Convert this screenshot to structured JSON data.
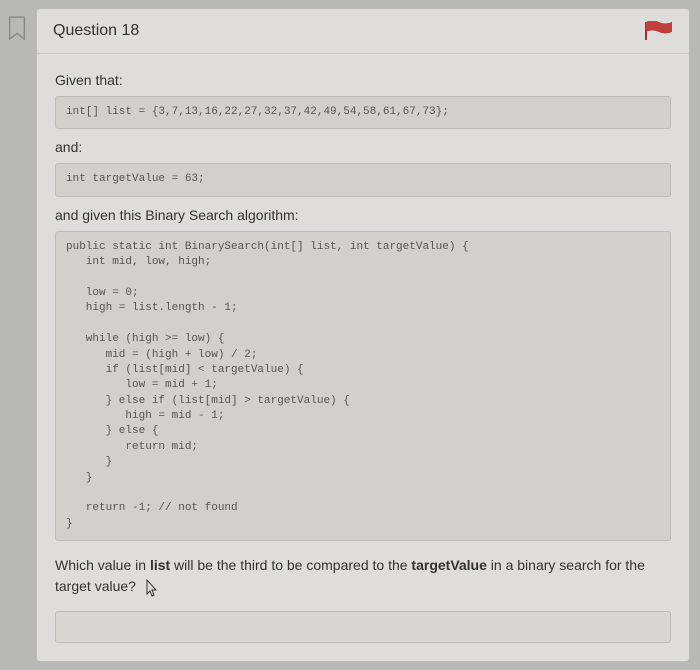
{
  "header": {
    "title": "Question 18"
  },
  "body": {
    "given_label": "Given that:",
    "code1": "int[] list = {3,7,13,16,22,27,32,37,42,49,54,58,61,67,73};",
    "and_label": "and:",
    "code2": "int targetValue = 63;",
    "algo_label": "and given this Binary Search algorithm:",
    "code3": "public static int BinarySearch(int[] list, int targetValue) {\n   int mid, low, high;\n\n   low = 0;\n   high = list.length - 1;\n\n   while (high >= low) {\n      mid = (high + low) / 2;\n      if (list[mid] < targetValue) {\n         low = mid + 1;\n      } else if (list[mid] > targetValue) {\n         high = mid - 1;\n      } else {\n         return mid;\n      }\n   }\n\n   return -1; // not found\n}"
  },
  "question": {
    "pre": "Which value in ",
    "bold1": "list",
    "mid": " will be the third to be compared to the ",
    "bold2": "targetValue",
    "post": " in a binary search for the target value?"
  }
}
